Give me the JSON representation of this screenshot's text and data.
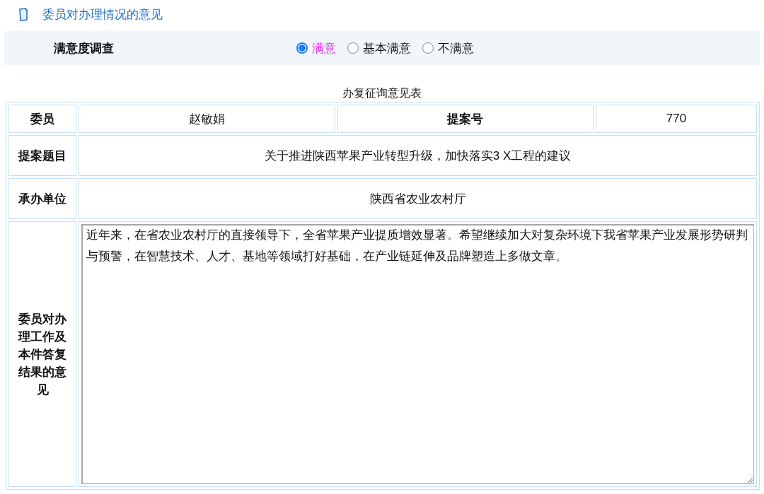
{
  "section_title": "委员对办理情况的意见",
  "survey": {
    "label": "满意度调查",
    "options": [
      {
        "label": "满意",
        "selected": true
      },
      {
        "label": "基本满意",
        "selected": false
      },
      {
        "label": "不满意",
        "selected": false
      }
    ]
  },
  "form": {
    "caption": "办复征询意见表",
    "member_label": "委员",
    "member": "赵敏娟",
    "proposal_no_label": "提案号",
    "proposal_no": "770",
    "title_label": "提案题目",
    "title": "关于推进陕西苹果产业转型升级，加快落实3 X工程的建议",
    "unit_label": "承办单位",
    "unit": "陕西省农业农村厅",
    "opinion_label": "委员对办理工作及本件答复结果的意见",
    "opinion": "近年来，在省农业农村厅的直接领导下，全省苹果产业提质增效显著。希望继续加大对复杂环境下我省苹果产业发展形势研判与预警，在智慧技术、人才、基地等领域打好基础，在产业链延伸及品牌塑造上多做文章。"
  }
}
